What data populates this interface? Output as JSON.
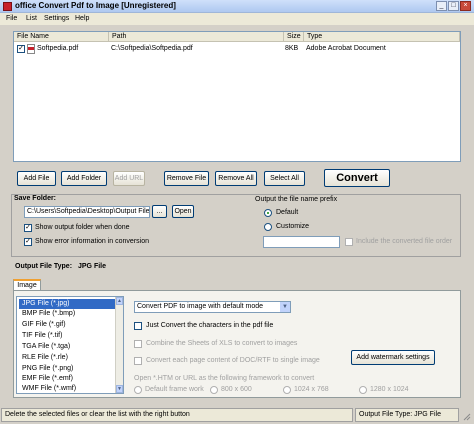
{
  "window": {
    "title": "office Convert Pdf to Image [Unregistered]",
    "minimize": "_",
    "maximize": "□",
    "close": "×"
  },
  "menu": [
    "File",
    "List",
    "Settings",
    "Help"
  ],
  "file_list": {
    "columns": [
      "File Name",
      "Path",
      "Size",
      "Type"
    ],
    "rows": [
      {
        "checked": true,
        "name": "Softpedia.pdf",
        "path": "C:\\Softpedia\\Softpedia.pdf",
        "size": "8KB",
        "type": "Adobe Acrobat Document"
      }
    ]
  },
  "toolbar": {
    "add_file": "Add File",
    "add_folder": "Add Folder",
    "add_url": "Add URL",
    "remove_file": "Remove File",
    "remove_all": "Remove All",
    "select_all": "Select All",
    "convert": "Convert"
  },
  "save_folder": {
    "label": "Save Folder:",
    "path": "C:\\Users\\Softpedia\\Desktop\\Output Files",
    "browse": "...",
    "open": "Open",
    "show_output": "Show output folder when done",
    "show_error": "Show error information in conversion"
  },
  "prefix": {
    "label": "Output the file name prefix",
    "default": "Default",
    "customize": "Customize",
    "include_order": "Include the converted file order"
  },
  "output_type": {
    "label": "Output File Type:",
    "value": "JPG File",
    "tab": "Image"
  },
  "types": [
    "JPG File (*.jpg)",
    "BMP File (*.bmp)",
    "GIF File (*.gif)",
    "TIF File (*.tif)",
    "TGA File (*.tga)",
    "RLE File (*.rle)",
    "PNG File (*.png)",
    "EMF File (*.emf)",
    "WMF File (*.wmf)"
  ],
  "options": {
    "mode": "Convert PDF to image with default mode",
    "just_convert": "Just Convert the characters in the pdf file",
    "combine_xls": "Combine the Sheets of XLS to convert to images",
    "each_page": "Convert each page content of DOC/RTF to single image",
    "watermark": "Add watermark settings",
    "framework": "Open *.HTM or URL as the following framework to convert",
    "default_frame": "Default frame work",
    "res1": "800 x 600",
    "res2": "1024 x 768",
    "res3": "1280 x 1024"
  },
  "status": {
    "left": "Delete the selected files or clear the list with the right button",
    "right": "Output File Type:  JPG File"
  }
}
